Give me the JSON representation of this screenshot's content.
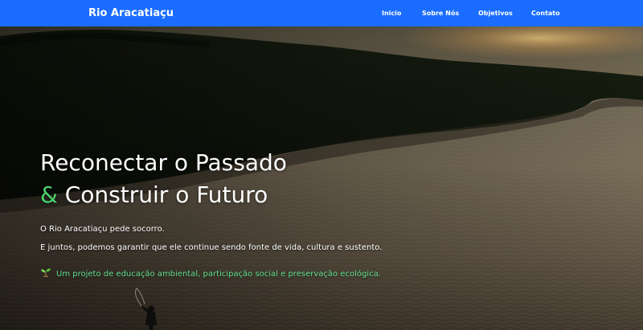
{
  "navbar": {
    "brand": "Rio Aracatiaçu",
    "links": [
      {
        "label": "Inicio"
      },
      {
        "label": "Sobre Nós"
      },
      {
        "label": "Objetivos"
      },
      {
        "label": "Contato"
      }
    ]
  },
  "hero": {
    "headline_line1": "Reconectar o Passado",
    "headline_amp": "&",
    "headline_line2": "Construir o Futuro",
    "paragraph1": "O Rio Aracatiaçu pede socorro.",
    "paragraph2": "E juntos, podemos garantir que ele continue sendo fonte de vida, cultura e sustento.",
    "tagline_icon": "seedling-icon",
    "tagline": "Um projeto de educação ambiental, participação social e preservação ecológica."
  },
  "colors": {
    "navbar_bg": "#1a6dff",
    "accent_green": "#49d46d",
    "tagline_green": "#64e18e"
  }
}
